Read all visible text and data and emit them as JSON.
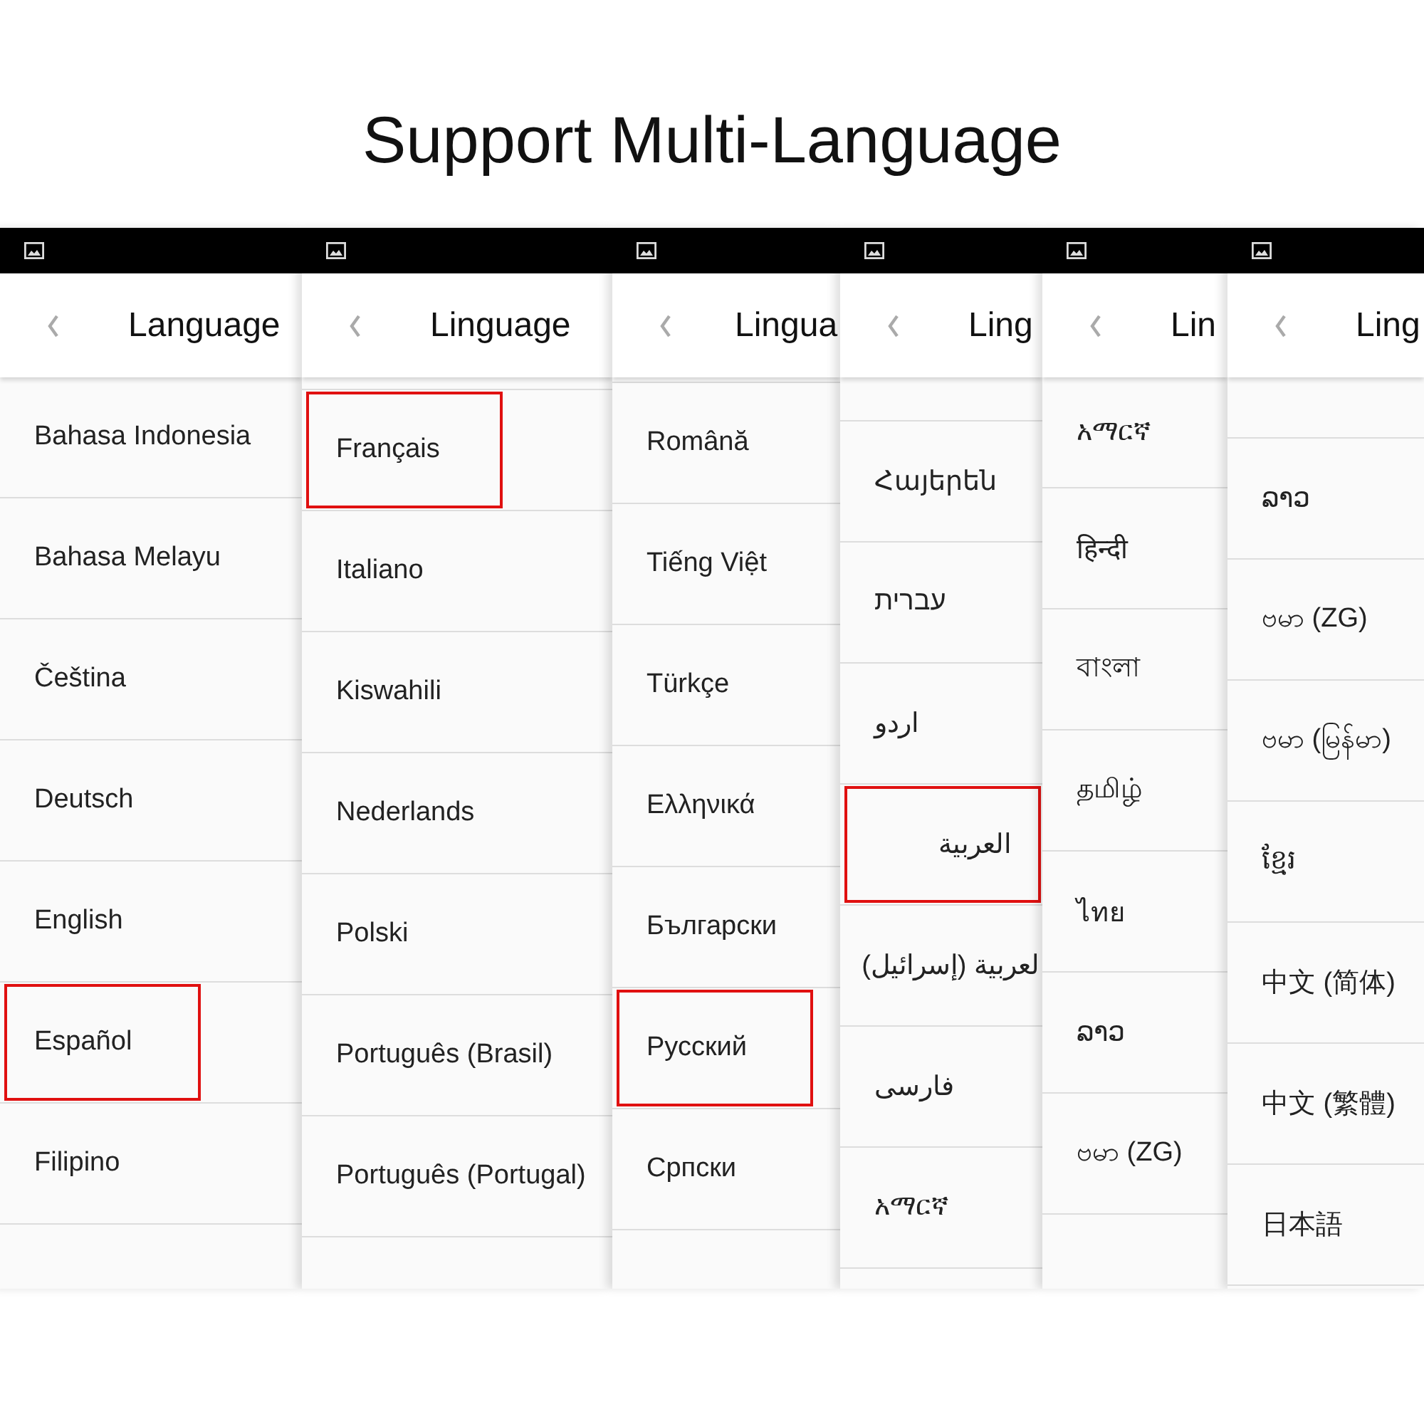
{
  "heading": "Support Multi-Language",
  "panels": [
    {
      "title": "Language",
      "items": [
        {
          "label": "Bahasa Indonesia",
          "selected": false
        },
        {
          "label": "Bahasa Melayu",
          "selected": false
        },
        {
          "label": "Čeština",
          "selected": false
        },
        {
          "label": "Deutsch",
          "selected": false
        },
        {
          "label": "English",
          "selected": false
        },
        {
          "label": "Español",
          "selected": true
        },
        {
          "label": "Filipino",
          "selected": false
        }
      ]
    },
    {
      "title": "Linguage",
      "items": [
        {
          "label": "Français",
          "selected": true
        },
        {
          "label": "Italiano",
          "selected": false
        },
        {
          "label": "Kiswahili",
          "selected": false
        },
        {
          "label": "Nederlands",
          "selected": false
        },
        {
          "label": "Polski",
          "selected": false
        },
        {
          "label": "Português (Brasil)",
          "selected": false
        },
        {
          "label": "Português (Portugal)",
          "selected": false
        }
      ]
    },
    {
      "title": "Lingua",
      "items": [
        {
          "label": "Română",
          "selected": false
        },
        {
          "label": "Tiếng Việt",
          "selected": false
        },
        {
          "label": "Türkçe",
          "selected": false
        },
        {
          "label": "Ελληνικά",
          "selected": false
        },
        {
          "label": "Български",
          "selected": false
        },
        {
          "label": "Русский",
          "selected": true
        },
        {
          "label": "Српски",
          "selected": false
        }
      ]
    },
    {
      "title": "Ling",
      "items": [
        {
          "label": "Հայերեն",
          "selected": false
        },
        {
          "label": "עברית",
          "selected": false
        },
        {
          "label": "اردو",
          "selected": false
        },
        {
          "label": "العربية",
          "selected": true
        },
        {
          "label": "لعربية (إسرائيل)",
          "selected": false
        },
        {
          "label": "فارسی",
          "selected": false
        },
        {
          "label": "አማርኛ",
          "selected": false
        }
      ]
    },
    {
      "title": "Lin",
      "items": [
        {
          "label": "አማርኛ",
          "selected": false
        },
        {
          "label": "हिन्दी",
          "selected": false
        },
        {
          "label": "বাংলা",
          "selected": false
        },
        {
          "label": "தமிழ்",
          "selected": false
        },
        {
          "label": "ไทย",
          "selected": false
        },
        {
          "label": "ລາວ",
          "selected": false
        },
        {
          "label": "ဗမာ (ZG)",
          "selected": false
        }
      ]
    },
    {
      "title": "Ling",
      "items": [
        {
          "label": "ລາວ",
          "selected": false
        },
        {
          "label": "ဗမာ (ZG)",
          "selected": false
        },
        {
          "label": "ဗမာ (မြန်မာ)",
          "selected": false
        },
        {
          "label": "ខ្មែរ",
          "selected": false
        },
        {
          "label": "中文 (简体)",
          "selected": false
        },
        {
          "label": "中文 (繁體)",
          "selected": false
        },
        {
          "label": "日本語",
          "selected": false
        }
      ]
    }
  ]
}
